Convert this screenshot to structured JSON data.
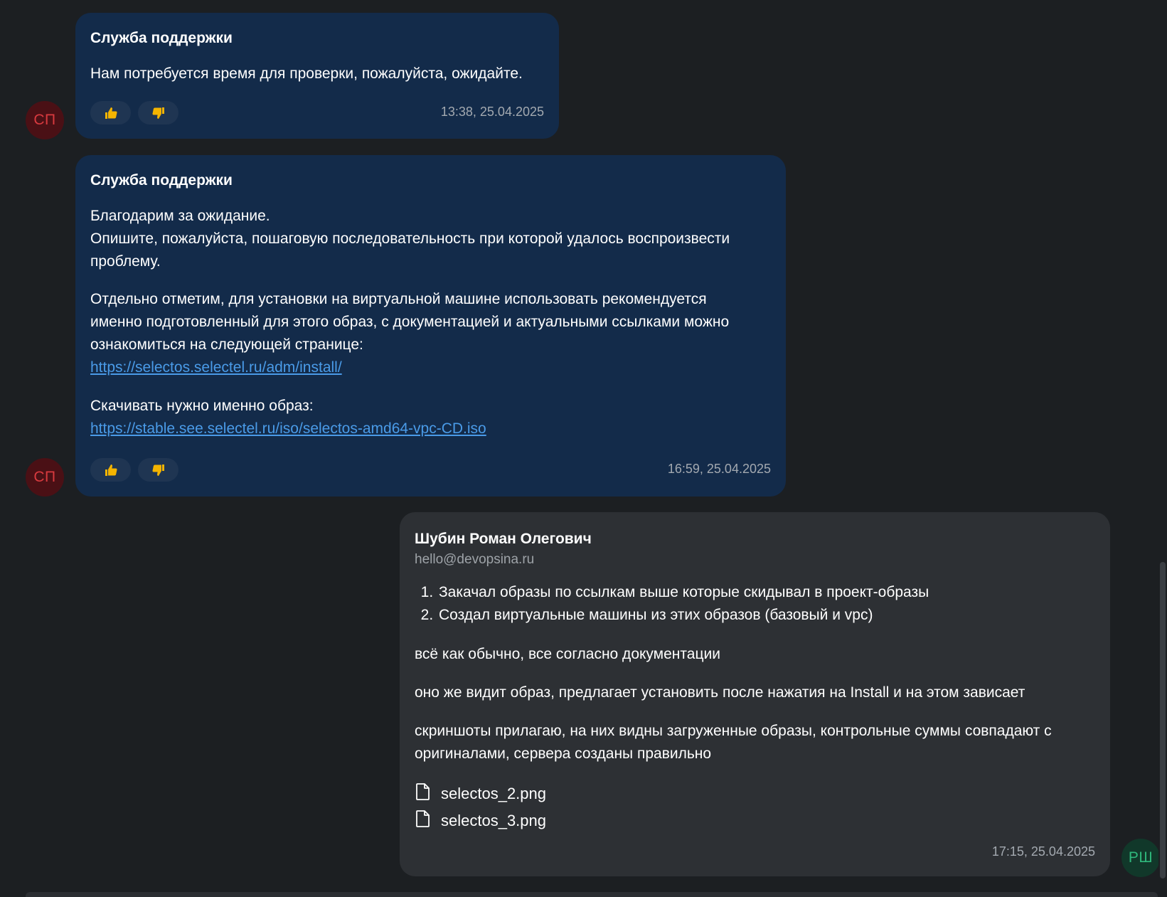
{
  "messages": [
    {
      "sender": "Служба поддержки",
      "avatar": "СП",
      "text": "Нам потребуется время для проверки, пожалуйста, ожидайте.",
      "time": "13:38, 25.04.2025",
      "reactions": {
        "like": "thumbs-up-icon",
        "dislike": "thumbs-down-icon"
      }
    },
    {
      "sender": "Служба поддержки",
      "avatar": "СП",
      "p1_line1": "Благодарим за ожидание.",
      "p1_line2": "Опишите, пожалуйста, пошаговую последовательность при которой удалось воспроизвести",
      "p1_line3": "проблему.",
      "p2_line1": "Отдельно отметим, для установки на виртуальной машине использовать рекомендуется",
      "p2_line2": "именно подготовленный для этого образ, с документацией и актуальными ссылками можно",
      "p2_line3": "ознакомиться на следующей странице:",
      "link1": "https://selectos.selectel.ru/adm/install/",
      "p3_line1": "Скачивать нужно именно образ:",
      "link2": "https://stable.see.selectel.ru/iso/selectos-amd64-vpc-CD.iso",
      "time": "16:59, 25.04.2025"
    },
    {
      "sender": "Шубин Роман Олегович",
      "email": "hello@devopsina.ru",
      "avatar": "РШ",
      "steps": [
        "Закачал образы по ссылкам выше которые скидывал в проект-образы",
        "Создал виртуальные машины из этих образов (базовый и vpc)"
      ],
      "p1": "всё как обычно, все согласно документации",
      "p2": "оно же видит образ, предлагает установить после нажатия на Install и на этом зависает",
      "p3_line1": "скриншоты прилагаю, на них видны загруженные образы, контрольные суммы совпадают с",
      "p3_line2": "оригиналами, сервера созданы правильно",
      "attachments": [
        "selectos_2.png",
        "selectos_3.png"
      ],
      "time": "17:15, 25.04.2025"
    }
  ],
  "colors": {
    "background": "#1c1f22",
    "support_bubble": "#132b4a",
    "user_bubble": "#2d3034",
    "link": "#4a9be8",
    "support_avatar": "#d83a3f",
    "user_avatar": "#2fb87c"
  }
}
